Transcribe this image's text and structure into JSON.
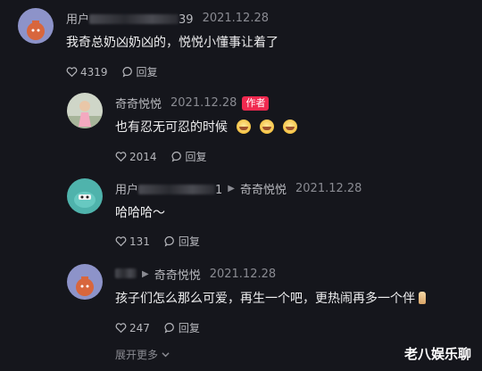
{
  "comments": [
    {
      "username_visible": "用户",
      "username_tail": "39",
      "date": "2021.12.28",
      "text": "我奇总奶凶奶凶的，悦悦小懂事让着了",
      "likes": "4319",
      "reply_label": "回复"
    },
    {
      "username": "奇奇悦悦",
      "date": "2021.12.28",
      "badge": "作者",
      "text": "也有忍无可忍的时候",
      "likes": "2014",
      "reply_label": "回复"
    },
    {
      "username_visible": "用户",
      "username_tail": "1",
      "reply_to": "奇奇悦悦",
      "date": "2021.12.28",
      "text": "哈哈哈～",
      "likes": "131",
      "reply_label": "回复"
    },
    {
      "username_visible": "",
      "reply_to": "奇奇悦悦",
      "date": "2021.12.28",
      "text": "孩子们怎么那么可爱，再生一个吧，更热闹再多一个伴",
      "likes": "247",
      "reply_label": "回复"
    }
  ],
  "expand_more": "展开更多",
  "watermark": "老八娱乐聊",
  "colors": {
    "background": "#15161c",
    "author_badge": "#f0294f",
    "secondary_text": "#9b9ca3"
  }
}
